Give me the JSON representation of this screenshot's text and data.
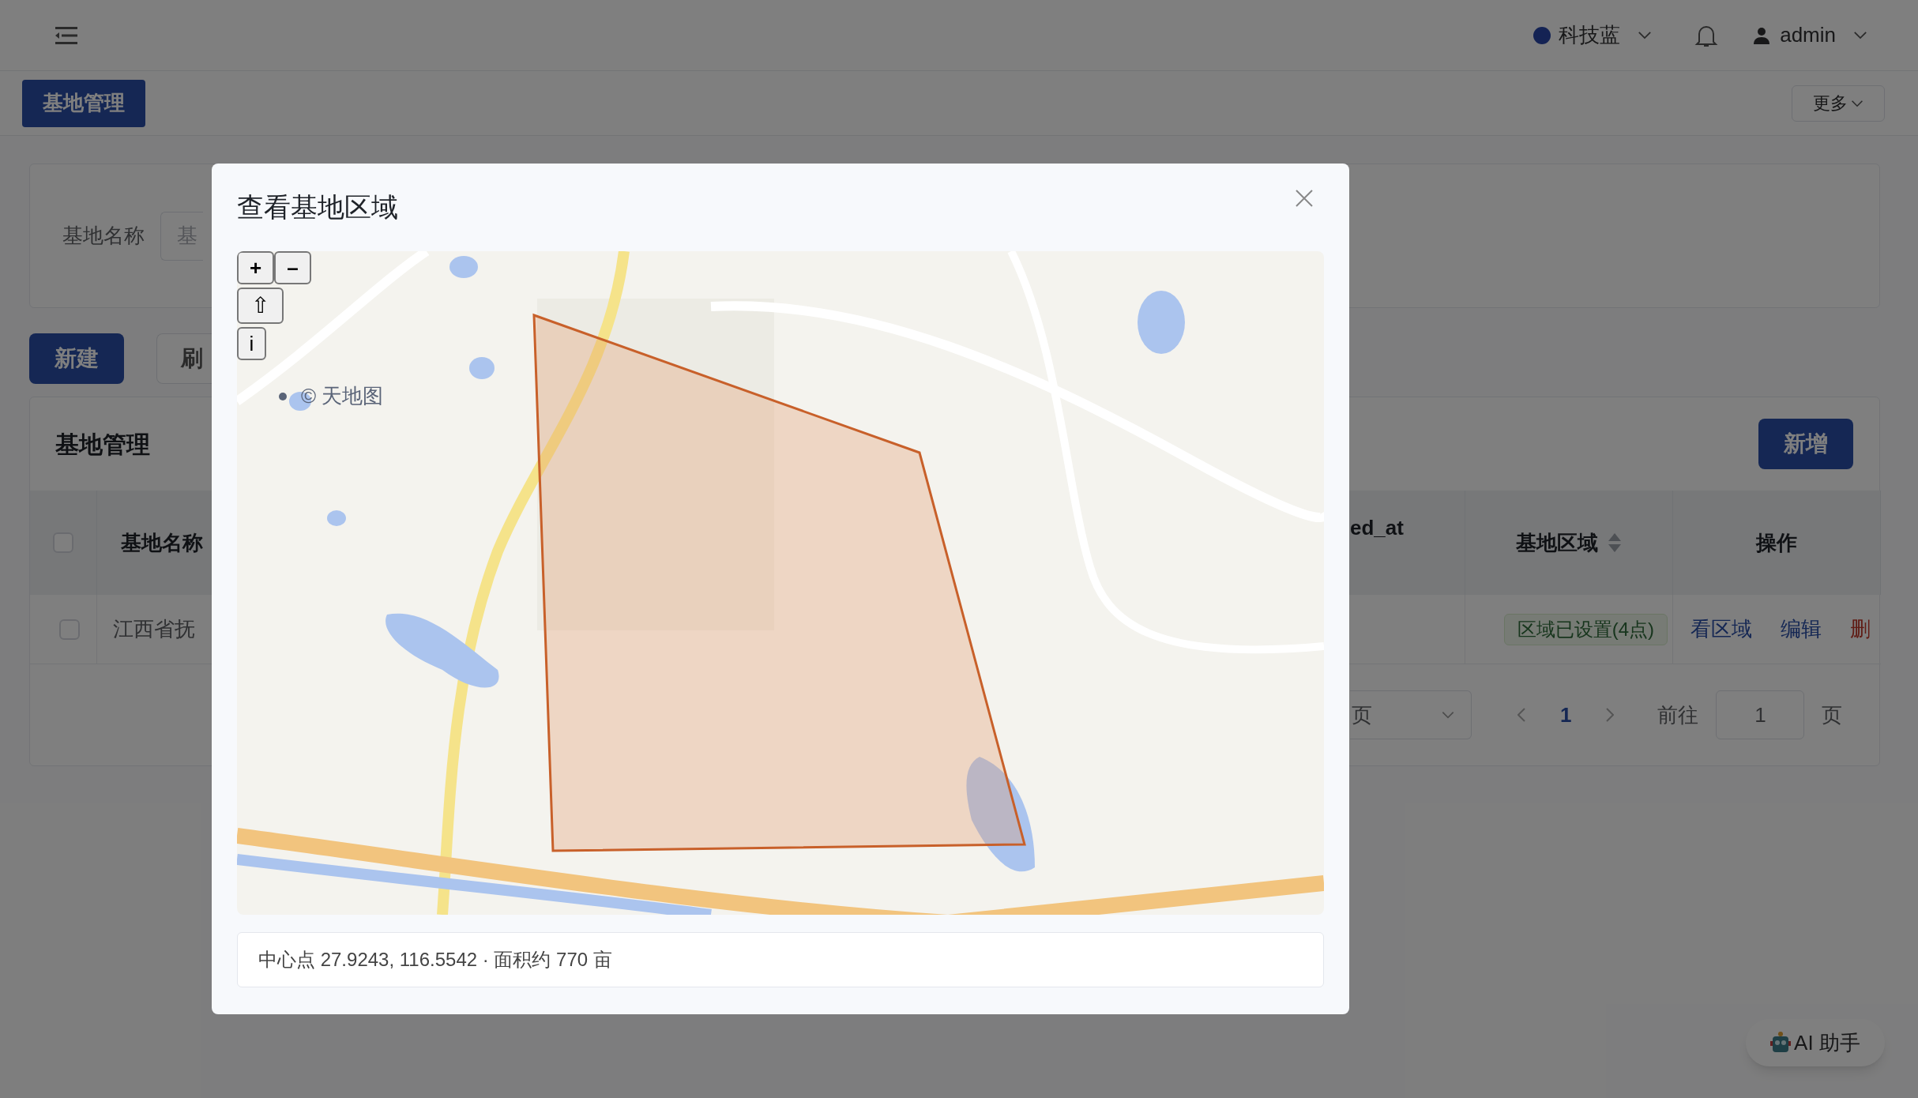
{
  "header": {
    "theme": "科技蓝",
    "user": "admin"
  },
  "tabs": [
    {
      "label": "基地管理",
      "selected": true
    }
  ],
  "more_button": "更多",
  "search": {
    "label": "基地名称",
    "placeholder": "基"
  },
  "toolbar": [
    "新建",
    "刷"
  ],
  "table_card": {
    "title": "基地管理",
    "add_button": "新增",
    "header_checked": false,
    "columns": [
      {
        "label": "基地名称"
      },
      {
        "label": "ed_at"
      },
      {
        "label": "基地区域",
        "sortable": true
      },
      {
        "label": "操作"
      }
    ],
    "rows": [
      {
        "checked": false,
        "name": "江西省抚",
        "region_status": "区域已设置(4点)",
        "actions": [
          "看区域",
          "编辑",
          "删"
        ]
      }
    ]
  },
  "pagination": {
    "page_size": "页",
    "pages": [
      {
        "label": "1",
        "selected": true
      }
    ],
    "goto_label": "前往",
    "goto_value": "1",
    "goto_suffix": "页"
  },
  "modal": {
    "title": "查看基地区域",
    "map": {
      "controls": [
        "+",
        "–",
        "⇧",
        "i"
      ],
      "attribution": "© 天地图"
    },
    "info": "中心点 27.9243, 116.5542 · 面积约 770 亩"
  },
  "ai_button": "AI 助手"
}
